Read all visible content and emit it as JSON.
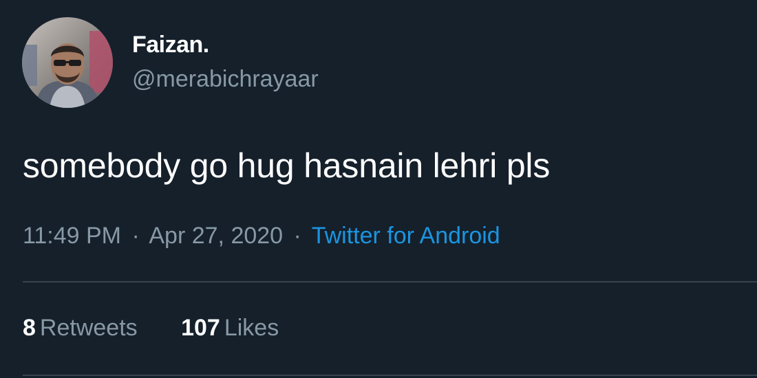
{
  "author": {
    "display_name": "Faizan.",
    "handle": "@merabichrayaar"
  },
  "tweet": {
    "text": "somebody go hug hasnain lehri pls",
    "time": "11:49 PM",
    "date": "Apr 27, 2020",
    "separator": "·",
    "source": "Twitter for Android"
  },
  "stats": {
    "retweets_count": "8",
    "retweets_label": "Retweets",
    "likes_count": "107",
    "likes_label": "Likes"
  },
  "colors": {
    "background": "#15202b",
    "primary_text": "#ffffff",
    "secondary_text": "#8899a6",
    "link": "#1b95e0",
    "divider": "#38444d"
  },
  "icons": {
    "avatar": "profile-photo"
  }
}
